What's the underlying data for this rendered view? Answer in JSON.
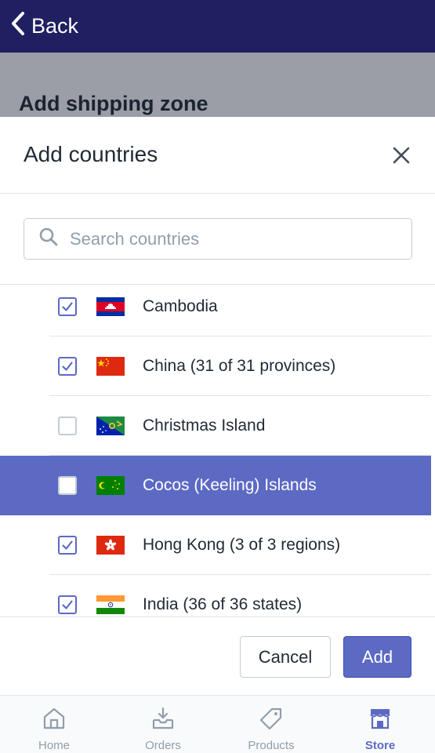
{
  "nav": {
    "back_label": "Back"
  },
  "background_page": {
    "title": "Add shipping zone"
  },
  "modal": {
    "title": "Add countries",
    "search": {
      "placeholder": "Search countries",
      "value": ""
    },
    "countries": [
      {
        "label": "Cambodia",
        "checked": true,
        "flag": "cambodia-flag"
      },
      {
        "label": "China (31 of 31 provinces)",
        "checked": true,
        "flag": "china-flag"
      },
      {
        "label": "Christmas Island",
        "checked": false,
        "flag": "christmas-island-flag"
      },
      {
        "label": "Cocos (Keeling) Islands",
        "checked": false,
        "flag": "cocos-islands-flag",
        "highlighted": true
      },
      {
        "label": "Hong Kong (3 of 3 regions)",
        "checked": true,
        "flag": "hong-kong-flag"
      },
      {
        "label": "India (36 of 36 states)",
        "checked": true,
        "flag": "india-flag"
      }
    ],
    "cancel_label": "Cancel",
    "add_label": "Add"
  },
  "tabs": [
    {
      "label": "Home",
      "icon": "home-icon",
      "active": false
    },
    {
      "label": "Orders",
      "icon": "orders-icon",
      "active": false
    },
    {
      "label": "Products",
      "icon": "tag-icon",
      "active": false
    },
    {
      "label": "Store",
      "icon": "store-icon",
      "active": true
    }
  ],
  "colors": {
    "topbar": "#1f1f62",
    "accent": "#5c6ac4",
    "muted": "#919eab"
  }
}
